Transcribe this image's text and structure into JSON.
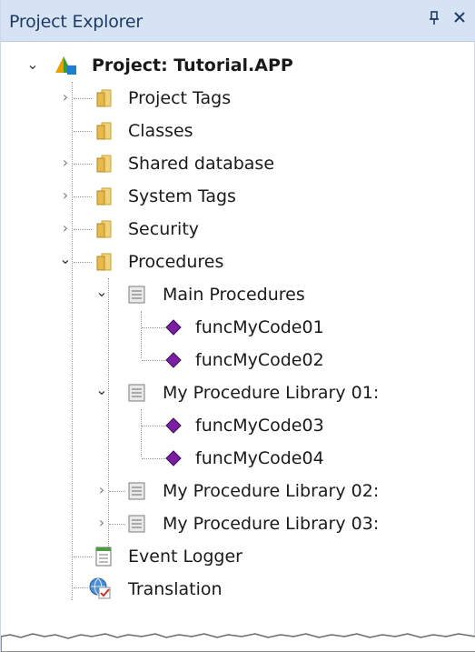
{
  "panel": {
    "title": "Project Explorer",
    "pin_icon": "pin-icon",
    "close_icon": "close-icon"
  },
  "tree": {
    "root": {
      "label": "Project: Tutorial.APP",
      "icon": "app-logo-icon",
      "expanded": true
    },
    "items": [
      {
        "label": "Project Tags",
        "icon": "folder-icon",
        "expandable": true,
        "expanded": false
      },
      {
        "label": "Classes",
        "icon": "folder-icon",
        "expandable": false
      },
      {
        "label": "Shared database",
        "icon": "folder-icon",
        "expandable": true,
        "expanded": false
      },
      {
        "label": "System Tags",
        "icon": "folder-icon",
        "expandable": true,
        "expanded": false
      },
      {
        "label": "Security",
        "icon": "folder-icon",
        "expandable": true,
        "expanded": false
      },
      {
        "label": "Procedures",
        "icon": "folder-icon",
        "expandable": true,
        "expanded": true
      },
      {
        "label": "Main Procedures",
        "icon": "script-icon",
        "expandable": true,
        "expanded": true
      },
      {
        "label": "funcMyCode01",
        "icon": "function-icon"
      },
      {
        "label": "funcMyCode02",
        "icon": "function-icon"
      },
      {
        "label": "My Procedure Library 01:",
        "icon": "script-icon",
        "expandable": true,
        "expanded": true
      },
      {
        "label": "funcMyCode03",
        "icon": "function-icon"
      },
      {
        "label": "funcMyCode04",
        "icon": "function-icon"
      },
      {
        "label": "My Procedure Library 02:",
        "icon": "script-icon",
        "expandable": true,
        "expanded": false
      },
      {
        "label": "My Procedure Library 03:",
        "icon": "script-icon",
        "expandable": true,
        "expanded": false
      },
      {
        "label": "Event Logger",
        "icon": "logger-icon"
      },
      {
        "label": "Translation",
        "icon": "translation-icon"
      }
    ]
  },
  "colors": {
    "titlebar": "#d6e3f4",
    "title_text": "#1f3b63",
    "function_gem": "#7b1fa2"
  }
}
